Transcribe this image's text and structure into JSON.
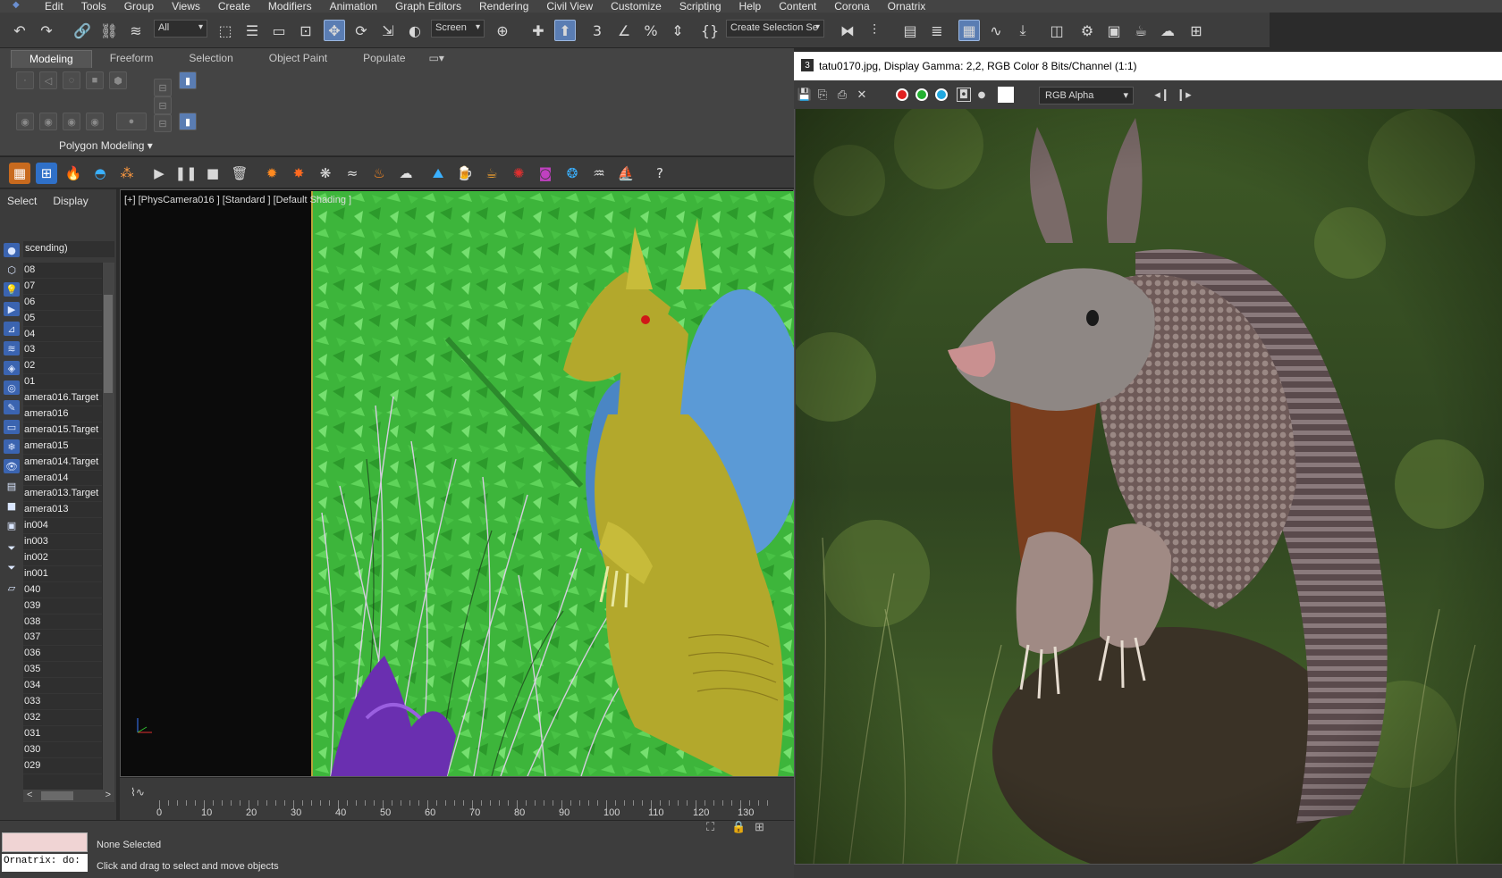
{
  "menu": [
    "Edit",
    "Tools",
    "Group",
    "Views",
    "Create",
    "Modifiers",
    "Animation",
    "Graph Editors",
    "Rendering",
    "Civil View",
    "Customize",
    "Scripting",
    "Help",
    "Content",
    "Corona",
    "Ornatrix"
  ],
  "toolbar": {
    "filter_value": "All",
    "coord_value": "Screen",
    "selection_set_value": "Create Selection Se"
  },
  "ribbon": {
    "tabs": [
      "Modeling",
      "Freeform",
      "Selection",
      "Object Paint",
      "Populate"
    ],
    "active_tab": "Modeling",
    "panel_label": "Polygon Modeling"
  },
  "scene_panel": {
    "tabs": [
      "Select",
      "Display"
    ],
    "sort_label": "scending)",
    "items": [
      "08",
      "07",
      "06",
      "05",
      "04",
      "03",
      "02",
      "01",
      "amera016.Target",
      "amera016",
      "amera015.Target",
      "amera015",
      "amera014.Target",
      "amera014",
      "amera013.Target",
      "amera013",
      "in004",
      "in003",
      "in002",
      "in001",
      "040",
      "039",
      "038",
      "037",
      "036",
      "035",
      "034",
      "033",
      "032",
      "031",
      "030",
      "029"
    ]
  },
  "viewport": {
    "label": "[+] [PhysCamera016 ] [Standard ] [Default Shading ]"
  },
  "timeline": {
    "ticks": [
      "0",
      "10",
      "20",
      "30",
      "40",
      "50",
      "60",
      "70",
      "80",
      "90",
      "100",
      "110",
      "120",
      "130"
    ]
  },
  "status": {
    "ornatrix_text": "Ornatrix: do:",
    "selection": "None Selected",
    "hint": "Click and drag to select and move objects"
  },
  "frame_buffer": {
    "title": "tatu0170.jpg, Display Gamma: 2,2, RGB Color 8 Bits/Channel (1:1)",
    "channel": "RGB Alpha",
    "channel_colors": [
      "#e02020",
      "#22b030",
      "#20a8e0"
    ]
  }
}
